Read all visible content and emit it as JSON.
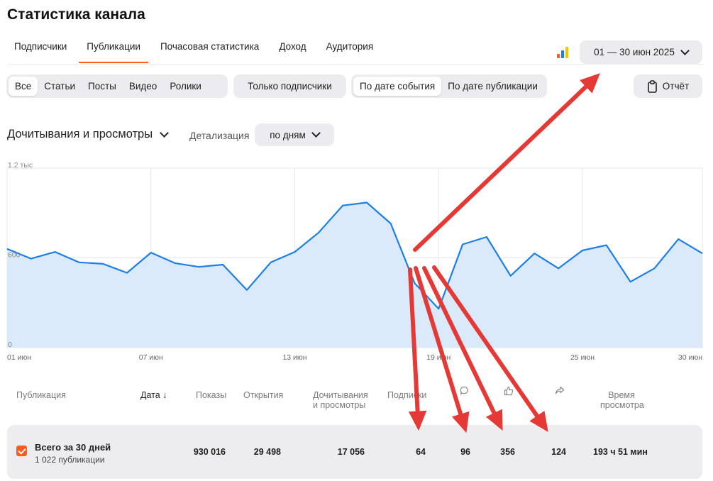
{
  "page": {
    "title": "Статистика канала"
  },
  "tabs": [
    {
      "label": "Подписчики",
      "active": false
    },
    {
      "label": "Публикации",
      "active": true
    },
    {
      "label": "Почасовая статистика",
      "active": false
    },
    {
      "label": "Доход",
      "active": false
    },
    {
      "label": "Аудитория",
      "active": false
    }
  ],
  "date_range": {
    "label": "01 — 30 июн 2025"
  },
  "filters": {
    "types": [
      "Все",
      "Статьи",
      "Посты",
      "Видео",
      "Ролики"
    ],
    "selected_type": "Все",
    "subscribers_only": "Только подписчики",
    "date_modes": [
      "По дате события",
      "По дате публикации"
    ],
    "selected_date_mode": "По дате события"
  },
  "report_button": {
    "label": "Отчёт"
  },
  "metric_selector": {
    "label": "Дочитывания и просмотры"
  },
  "detail": {
    "label": "Детализация",
    "value": "по дням"
  },
  "colors": {
    "accent": "#ff5a1f",
    "line": "#1a7fe8",
    "area": "#dbeafb",
    "annotation_arrow": "#e53935"
  },
  "icons": {
    "stats": "bar-chart-icon",
    "report": "clipboard-icon",
    "dropdown": "chevron-down-icon",
    "comments": "comment-icon",
    "likes": "thumbs-up-icon",
    "shares": "share-icon"
  },
  "chart_data": {
    "type": "area",
    "x": [
      "01 июн",
      "02 июн",
      "03 июн",
      "04 июн",
      "05 июн",
      "06 июн",
      "07 июн",
      "08 июн",
      "09 июн",
      "10 июн",
      "11 июн",
      "12 июн",
      "13 июн",
      "14 июн",
      "15 июн",
      "16 июн",
      "17 июн",
      "18 июн",
      "19 июн",
      "20 июн",
      "21 июн",
      "22 июн",
      "23 июн",
      "24 июн",
      "25 июн",
      "26 июн",
      "27 июн",
      "28 июн",
      "29 июн",
      "30 июн"
    ],
    "series": [
      {
        "values": [
          660,
          595,
          640,
          570,
          560,
          500,
          635,
          565,
          540,
          555,
          385,
          570,
          640,
          770,
          950,
          970,
          830,
          430,
          260,
          690,
          740,
          480,
          630,
          530,
          650,
          685,
          440,
          530,
          725,
          630
        ]
      }
    ],
    "ylim": [
      0,
      1200
    ],
    "yticks": [
      "0",
      "600",
      "1.2 тыс"
    ],
    "xticks": [
      "01 июн",
      "07 июн",
      "13 июн",
      "19 июн",
      "25 июн",
      "30 июн"
    ],
    "grid": true
  },
  "table": {
    "headers": {
      "publication": "Публикация",
      "date": "Дата",
      "date_sort": "↓",
      "views": "Показы",
      "opens": "Открытия",
      "reads_line1": "Дочитывания",
      "reads_line2": "и просмотры",
      "subscriptions": "Подписки",
      "time_line1": "Время",
      "time_line2": "просмотра"
    },
    "total": {
      "title": "Всего за 30 дней",
      "subtitle": "1 022 публикации",
      "views": "930 016",
      "opens": "29 498",
      "reads": "17 056",
      "subscriptions": "64",
      "comments": "96",
      "likes": "356",
      "shares": "124",
      "time": "193 ч 51 мин"
    }
  }
}
